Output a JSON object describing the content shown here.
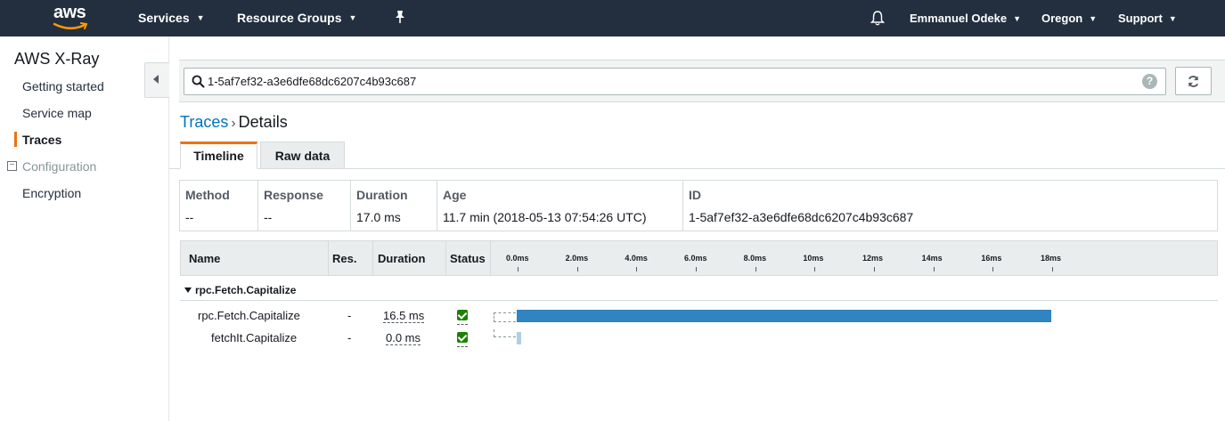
{
  "topnav": {
    "logo_text": "aws",
    "services": "Services",
    "resource_groups": "Resource Groups",
    "user": "Emmanuel Odeke",
    "region": "Oregon",
    "support": "Support"
  },
  "sidebar": {
    "title": "AWS X-Ray",
    "items": [
      {
        "label": "Getting started"
      },
      {
        "label": "Service map"
      },
      {
        "label": "Traces"
      },
      {
        "label": "Configuration"
      },
      {
        "label": "Encryption"
      }
    ],
    "active": "Traces"
  },
  "search": {
    "value": "1-5af7ef32-a3e6dfe68dc6207c4b93c687",
    "help_glyph": "?"
  },
  "breadcrumb": {
    "link": "Traces",
    "separator": "›",
    "current": "Details"
  },
  "tabs": [
    {
      "label": "Timeline",
      "active": true
    },
    {
      "label": "Raw data",
      "active": false
    }
  ],
  "summary": {
    "headers": [
      "Method",
      "Response",
      "Duration",
      "Age",
      "ID"
    ],
    "values": [
      "--",
      "--",
      "17.0 ms",
      "11.7 min (2018-05-13 07:54:26 UTC)",
      "1-5af7ef32-a3e6dfe68dc6207c4b93c687"
    ]
  },
  "timeline": {
    "columns": [
      "Name",
      "Res.",
      "Duration",
      "Status"
    ],
    "ticks": [
      "0.0ms",
      "2.0ms",
      "4.0ms",
      "6.0ms",
      "8.0ms",
      "10ms",
      "12ms",
      "14ms",
      "16ms",
      "18ms"
    ],
    "group": "rpc.Fetch.Capitalize",
    "rows": [
      {
        "name": "rpc.Fetch.Capitalize",
        "res": "-",
        "duration": "16.5 ms",
        "status": "ok",
        "start_ms": 0.0,
        "duration_ms": 16.5
      },
      {
        "name": "fetchIt.Capitalize",
        "res": "-",
        "duration": "0.0 ms",
        "status": "ok",
        "start_ms": 0.0,
        "duration_ms": 0.0
      }
    ],
    "accent": "#3184c2"
  },
  "colors": {
    "nav_bg": "#232f3e",
    "accent_orange": "#ec7211",
    "link_blue": "#0073bb",
    "status_green": "#1d8102"
  }
}
